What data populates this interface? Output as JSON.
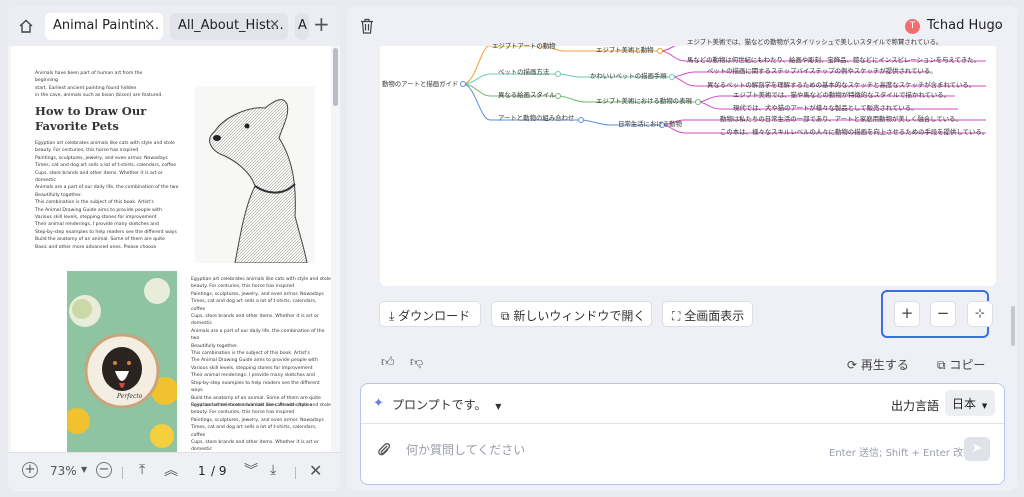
{
  "tabs": {
    "home_icon": "home-icon",
    "items": [
      {
        "label": "Animal Paintin…",
        "close": "×"
      },
      {
        "label": "All_About_Hist…",
        "close": "×"
      },
      {
        "label": "A"
      }
    ],
    "add": "+"
  },
  "doc": {
    "intro": [
      "Animals have been part of human art from the beginning",
      "start. Earliest ancient painting found hidden",
      "in the cave, animals such as bison (bison) are featured."
    ],
    "heading1": "How to Draw Our",
    "heading2": "Favorite Pets",
    "para1": [
      "Egyptian art celebrates animals like cats with style and stole",
      "beauty. For centuries, this horse has inspired",
      "Paintings, sculptures, jewelry, and even armor. Nowadays",
      "Times, cat and dog art sells a lot of t-shirts, calendars, coffee",
      "Cups, store brands and other items. Whether it is art or domestic",
      "Animals are a part of our daily life, the combination of the two",
      "Beautifully together.",
      "This combination is the subject of this book. Artist's",
      "The Animal Drawing Guide aims to provide people with",
      "Various skill levels, stepping stones for improvement",
      "Their animal renderings. I provide many sketches and",
      "Step-by-step examples to help readers see the different ways",
      "Build the anatomy of an animal. Some of them are quite",
      "Basic and other more advanced ones. Please choose"
    ],
    "para2": [
      "Egyptian art celebrates animals like cats with style and stole",
      "beauty. For centuries, this horse has inspired",
      "Paintings, sculptures, jewelry, and even armor. Nowadays",
      "Times, cat and dog art sells a lot of t-shirts, calendars, coffee",
      "Cups, store brands and other items. Whether it is art or domestic",
      "Animals are a part of our daily life, the combination of the two",
      "Beautifully together.",
      "This combination is the subject of this book. Artist's",
      "The Animal Drawing Guide aims to provide people with",
      "Various skill levels, stepping stones for improvement",
      "Their animal renderings. I provide many sketches and",
      "Step-by-step examples to help readers see the different ways",
      "Build the anatomy of an animal. Some of them are quite",
      "Basic and other more advanced ones. Please choose"
    ],
    "para3": [
      "Egyptian art celebrates animals like cats with style and stole",
      "beauty. For centuries, this horse has inspired",
      "Paintings, sculptures, jewelry, and even armor. Nowadays",
      "Times, cat and dog art sells a lot of t-shirts, calendars, coffee",
      "Cups, store brands and other items. Whether it is art or domestic"
    ],
    "embroidery_text": "Perfecto"
  },
  "pdfbar": {
    "zoom": "73%",
    "page": "1",
    "total": "/ 9"
  },
  "user": {
    "initial": "T",
    "name": "Tchad Hugo",
    "accent": "#f26d6d"
  },
  "mindmap": {
    "root": "動物のアートと描画ガイド",
    "top": "エジプトアートの動物",
    "b1": {
      "label": "ペットの描画方法",
      "sub": "かわいいペットの描画手順",
      "leaves": [
        "ペットの描画に関するステップバイステップの例やスケッチが提供されている。",
        "異なるペットの解剖学を理解するための基本的なスケッチと高度なスケッチが含まれている。"
      ]
    },
    "b0": {
      "sub": "エジプト美術と動物",
      "leaves": [
        "エジプト美術では、猫などの動物がスタイリッシュで美しいスタイルで称賛されている。",
        "馬などの動物は何世紀にもわたり、絵画や彫刻、宝飾品、鎧などにインスピレーションを与えてきた。"
      ]
    },
    "b2": {
      "label": "異なる絵画スタイル",
      "sub": "エジプト美術における動物の表現",
      "leaves": [
        "エジプト美術では、猫や馬などの動物が特徴的なスタイルで描かれている。",
        "現代では、犬や猫のアートが様々な製品として販売されている。"
      ]
    },
    "b3": {
      "label": "アートと動物の組み合わせ",
      "sub": "日常生活における動物",
      "leaves": [
        "動物は私たちの日常生活の一部であり、アートと家庭用動物が美しく融合している。",
        "この本は、様々なスキルレベルの人々に動物の描画を向上させるための手段を提供している。"
      ]
    }
  },
  "actions": {
    "download": "ダウンロード",
    "new_window": "新しいウィンドウで開く",
    "fullscreen": "全画面表示",
    "zoom_in": "+",
    "zoom_out": "−"
  },
  "feedback": {
    "regenerate": "再生する",
    "copy": "コピー"
  },
  "prompt": {
    "label": "プロンプトです。",
    "lang_label": "出力言語",
    "lang_value": "日本",
    "placeholder": "何か質問してください",
    "hint": "Enter 送信; Shift + Enter 改行"
  }
}
